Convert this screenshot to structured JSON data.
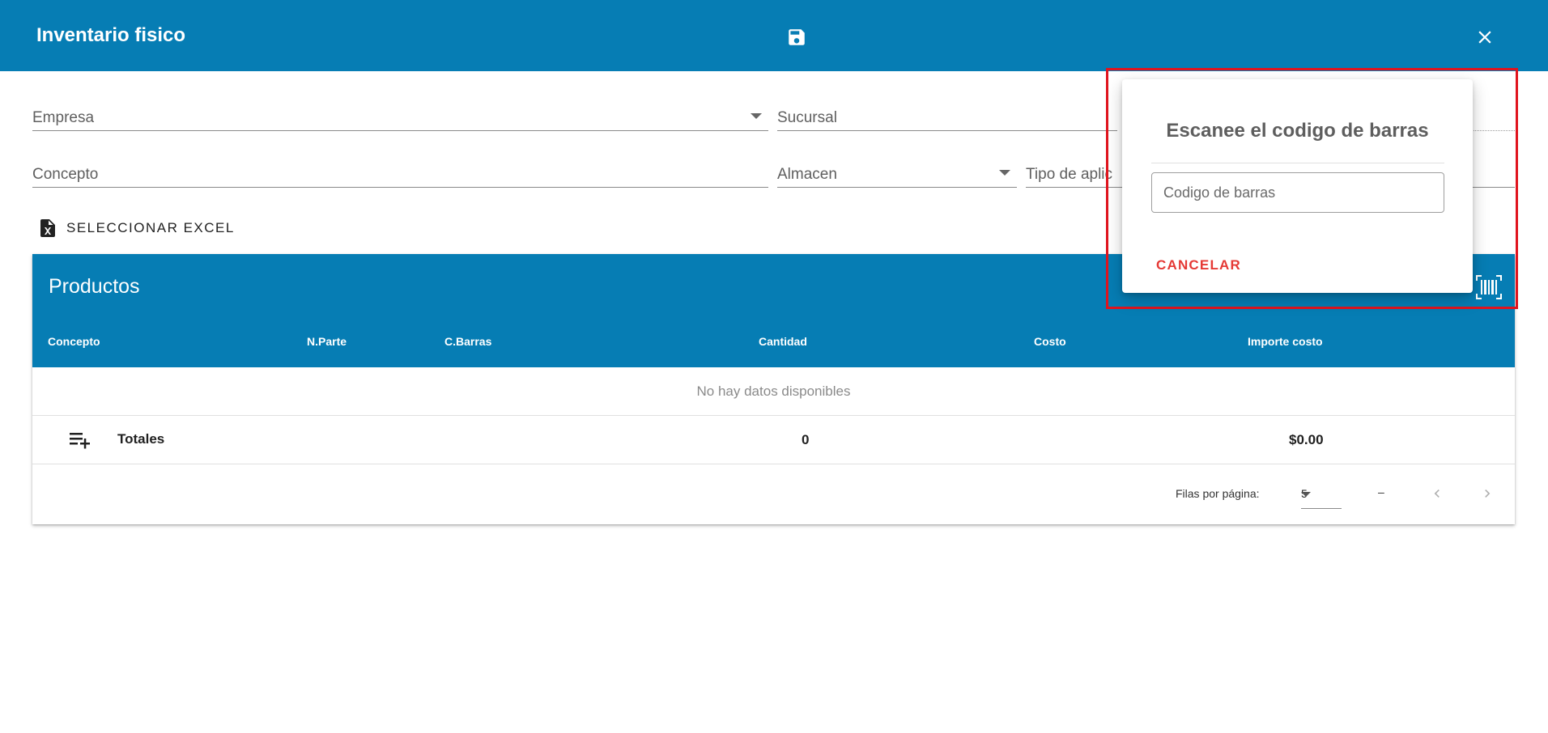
{
  "appbar": {
    "title": "Inventario fisico",
    "save_icon": "floppy-disk-icon",
    "close_icon": "close-icon"
  },
  "form": {
    "empresa_label": "Empresa",
    "sucursal_label": "Sucursal",
    "concepto_label": "Concepto",
    "almacen_label": "Almacen",
    "tipo_label": "Tipo de aplic"
  },
  "excel_button": {
    "label": "SELECCIONAR EXCEL",
    "icon": "excel-file-icon"
  },
  "table": {
    "title": "Productos",
    "columns": [
      "Concepto",
      "N.Parte",
      "C.Barras",
      "Cantidad",
      "Costo",
      "Importe costo"
    ],
    "empty_text": "No hay datos disponibles",
    "totals": {
      "label": "Totales",
      "quantity": "0",
      "amount": "$0.00"
    },
    "footer": {
      "rows_per_page_label": "Filas por página:",
      "rows_per_page_value": "5",
      "range": "–"
    }
  },
  "dialog": {
    "title": "Escanee el codigo de barras",
    "input_placeholder": "Codigo de barras",
    "input_value": "",
    "cancel_label": "CANCELAR"
  },
  "colors": {
    "primary": "#067db4",
    "danger": "#e53935",
    "highlight": "#e0141e"
  }
}
